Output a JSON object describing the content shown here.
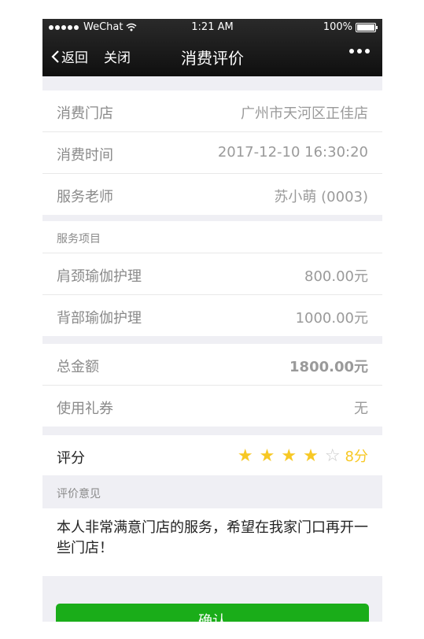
{
  "status_bar": {
    "carrier": "WeChat",
    "time": "1:21 AM",
    "battery": "100%"
  },
  "nav": {
    "back_label": "返回",
    "close_label": "关闭",
    "title": "消费评价"
  },
  "info": [
    {
      "label": "消费门店",
      "value": "广州市天河区正佳店"
    },
    {
      "label": "消费时间",
      "value": "2017-12-10 16:30:20"
    },
    {
      "label": "服务老师",
      "value": "苏小萌 (0003)"
    }
  ],
  "services": {
    "header": "服务项目",
    "items": [
      {
        "name": "肩颈瑜伽护理",
        "price": "800.00元"
      },
      {
        "name": "背部瑜伽护理",
        "price": "1000.00元"
      }
    ]
  },
  "summary": {
    "total_label": "总金额",
    "total_value": "1800.00元",
    "coupon_label": "使用礼券",
    "coupon_value": "无"
  },
  "rating": {
    "label": "评分",
    "stars": 4,
    "max_stars": 5,
    "score_text": "8分",
    "star_color": "#f7c824"
  },
  "opinion": {
    "header": "评价意见",
    "text": "本人非常满意门店的服务，希望在我家门口再开一些门店！"
  },
  "confirm_label": "确认",
  "colors": {
    "accent": "#1aad19",
    "nav_bg": "#1a1a1a"
  }
}
